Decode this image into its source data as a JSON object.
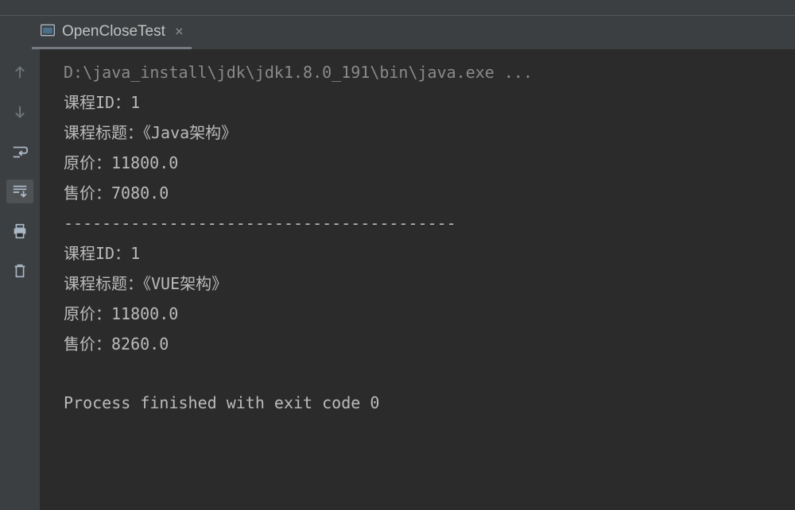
{
  "tab": {
    "title": "OpenCloseTest",
    "close": "×"
  },
  "console": {
    "command": "D:\\java_install\\jdk\\jdk1.8.0_191\\bin\\java.exe ...",
    "lines": [
      "课程ID：1",
      "课程标题：《Java架构》",
      "原价：11800.0",
      "售价：7080.0",
      "-----------------------------------------",
      "课程ID：1",
      "课程标题：《VUE架构》",
      "原价：11800.0",
      "售价：8260.0"
    ],
    "exit": "Process finished with exit code 0"
  },
  "icons": {
    "run": "run-tab",
    "up": "up-arrow",
    "down": "down-arrow",
    "wrap": "soft-wrap",
    "scroll": "scroll-to-end",
    "print": "print",
    "trash": "trash"
  }
}
